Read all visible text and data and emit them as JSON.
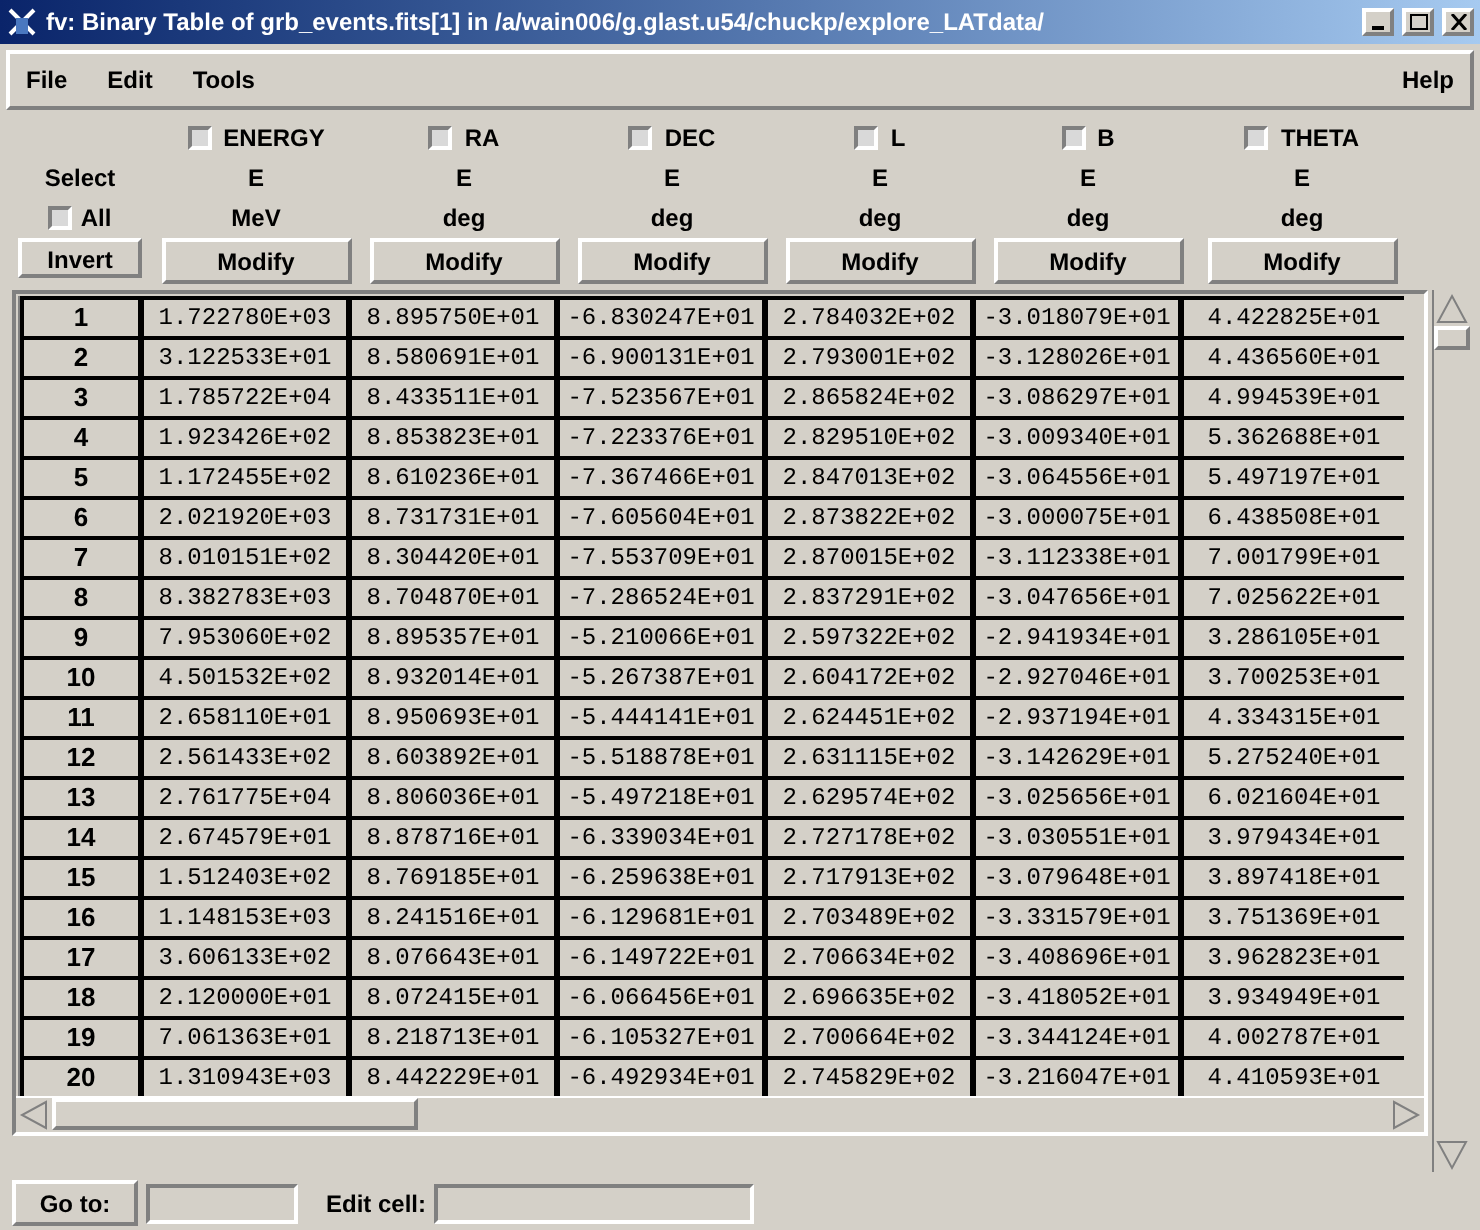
{
  "window": {
    "title": "fv: Binary Table of grb_events.fits[1] in /a/wain006/g.glast.u54/chuckp/explore_LATdata/"
  },
  "menu": [
    "File",
    "Edit",
    "Tools"
  ],
  "help_menu": "Help",
  "select_label": "Select",
  "all": {
    "label": "All",
    "checked": false
  },
  "invert_button": "Invert",
  "columns": [
    {
      "name": "ENERGY",
      "selected": false,
      "format": "E",
      "unit": "MeV",
      "button": "Modify"
    },
    {
      "name": "RA",
      "selected": false,
      "format": "E",
      "unit": "deg",
      "button": "Modify"
    },
    {
      "name": "DEC",
      "selected": false,
      "format": "E",
      "unit": "deg",
      "button": "Modify"
    },
    {
      "name": "L",
      "selected": false,
      "format": "E",
      "unit": "deg",
      "button": "Modify"
    },
    {
      "name": "B",
      "selected": false,
      "format": "E",
      "unit": "deg",
      "button": "Modify"
    },
    {
      "name": "THETA",
      "selected": false,
      "format": "E",
      "unit": "deg",
      "button": "Modify"
    }
  ],
  "rows": [
    {
      "number": "1",
      "cells": [
        "1.722780E+03",
        "8.895750E+01",
        "-6.830247E+01",
        "2.784032E+02",
        "-3.018079E+01",
        "4.422825E+01"
      ]
    },
    {
      "number": "2",
      "cells": [
        "3.122533E+01",
        "8.580691E+01",
        "-6.900131E+01",
        "2.793001E+02",
        "-3.128026E+01",
        "4.436560E+01"
      ]
    },
    {
      "number": "3",
      "cells": [
        "1.785722E+04",
        "8.433511E+01",
        "-7.523567E+01",
        "2.865824E+02",
        "-3.086297E+01",
        "4.994539E+01"
      ]
    },
    {
      "number": "4",
      "cells": [
        "1.923426E+02",
        "8.853823E+01",
        "-7.223376E+01",
        "2.829510E+02",
        "-3.009340E+01",
        "5.362688E+01"
      ]
    },
    {
      "number": "5",
      "cells": [
        "1.172455E+02",
        "8.610236E+01",
        "-7.367466E+01",
        "2.847013E+02",
        "-3.064556E+01",
        "5.497197E+01"
      ]
    },
    {
      "number": "6",
      "cells": [
        "2.021920E+03",
        "8.731731E+01",
        "-7.605604E+01",
        "2.873822E+02",
        "-3.000075E+01",
        "6.438508E+01"
      ]
    },
    {
      "number": "7",
      "cells": [
        "8.010151E+02",
        "8.304420E+01",
        "-7.553709E+01",
        "2.870015E+02",
        "-3.112338E+01",
        "7.001799E+01"
      ]
    },
    {
      "number": "8",
      "cells": [
        "8.382783E+03",
        "8.704870E+01",
        "-7.286524E+01",
        "2.837291E+02",
        "-3.047656E+01",
        "7.025622E+01"
      ]
    },
    {
      "number": "9",
      "cells": [
        "7.953060E+02",
        "8.895357E+01",
        "-5.210066E+01",
        "2.597322E+02",
        "-2.941934E+01",
        "3.286105E+01"
      ]
    },
    {
      "number": "10",
      "cells": [
        "4.501532E+02",
        "8.932014E+01",
        "-5.267387E+01",
        "2.604172E+02",
        "-2.927046E+01",
        "3.700253E+01"
      ]
    },
    {
      "number": "11",
      "cells": [
        "2.658110E+01",
        "8.950693E+01",
        "-5.444141E+01",
        "2.624451E+02",
        "-2.937194E+01",
        "4.334315E+01"
      ]
    },
    {
      "number": "12",
      "cells": [
        "2.561433E+02",
        "8.603892E+01",
        "-5.518878E+01",
        "2.631115E+02",
        "-3.142629E+01",
        "5.275240E+01"
      ]
    },
    {
      "number": "13",
      "cells": [
        "2.761775E+04",
        "8.806036E+01",
        "-5.497218E+01",
        "2.629574E+02",
        "-3.025656E+01",
        "6.021604E+01"
      ]
    },
    {
      "number": "14",
      "cells": [
        "2.674579E+01",
        "8.878716E+01",
        "-6.339034E+01",
        "2.727178E+02",
        "-3.030551E+01",
        "3.979434E+01"
      ]
    },
    {
      "number": "15",
      "cells": [
        "1.512403E+02",
        "8.769185E+01",
        "-6.259638E+01",
        "2.717913E+02",
        "-3.079648E+01",
        "3.897418E+01"
      ]
    },
    {
      "number": "16",
      "cells": [
        "1.148153E+03",
        "8.241516E+01",
        "-6.129681E+01",
        "2.703489E+02",
        "-3.331579E+01",
        "3.751369E+01"
      ]
    },
    {
      "number": "17",
      "cells": [
        "3.606133E+02",
        "8.076643E+01",
        "-6.149722E+01",
        "2.706634E+02",
        "-3.408696E+01",
        "3.962823E+01"
      ]
    },
    {
      "number": "18",
      "cells": [
        "2.120000E+01",
        "8.072415E+01",
        "-6.066456E+01",
        "2.696635E+02",
        "-3.418052E+01",
        "3.934949E+01"
      ]
    },
    {
      "number": "19",
      "cells": [
        "7.061363E+01",
        "8.218713E+01",
        "-6.105327E+01",
        "2.700664E+02",
        "-3.344124E+01",
        "4.002787E+01"
      ]
    },
    {
      "number": "20",
      "cells": [
        "1.310943E+03",
        "8.442229E+01",
        "-6.492934E+01",
        "2.745829E+02",
        "-3.216047E+01",
        "4.410593E+01"
      ]
    }
  ],
  "footer": {
    "goto_button": "Go to:",
    "edit_cell_label": "Edit cell:"
  }
}
